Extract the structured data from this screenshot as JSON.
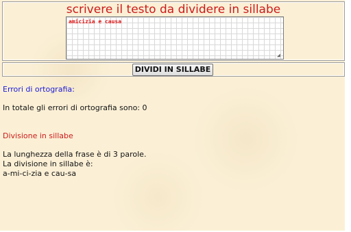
{
  "form": {
    "heading": "scrivere il testo da dividere in sillabe",
    "textarea_value": "amicizia e causa",
    "button_label": "DIVIDI IN SILLABE"
  },
  "spelling": {
    "title": "Errori di ortografia:",
    "total_text": "In totale gli errori di ortografia sono: 0"
  },
  "syllables": {
    "title": "Divisione in sillabe",
    "length_text": "La lunghezza della frase è di 3 parole.",
    "division_label": "La divisione in sillabe è:",
    "result": "a-mi-ci-zia e cau-sa"
  },
  "colors": {
    "background": "#fbf0d6",
    "heading": "#cc1a1a",
    "section_blue": "#1a1ad6",
    "section_red": "#cc1a1a"
  },
  "icons": {
    "textarea_resize": "resize-grip-icon"
  }
}
